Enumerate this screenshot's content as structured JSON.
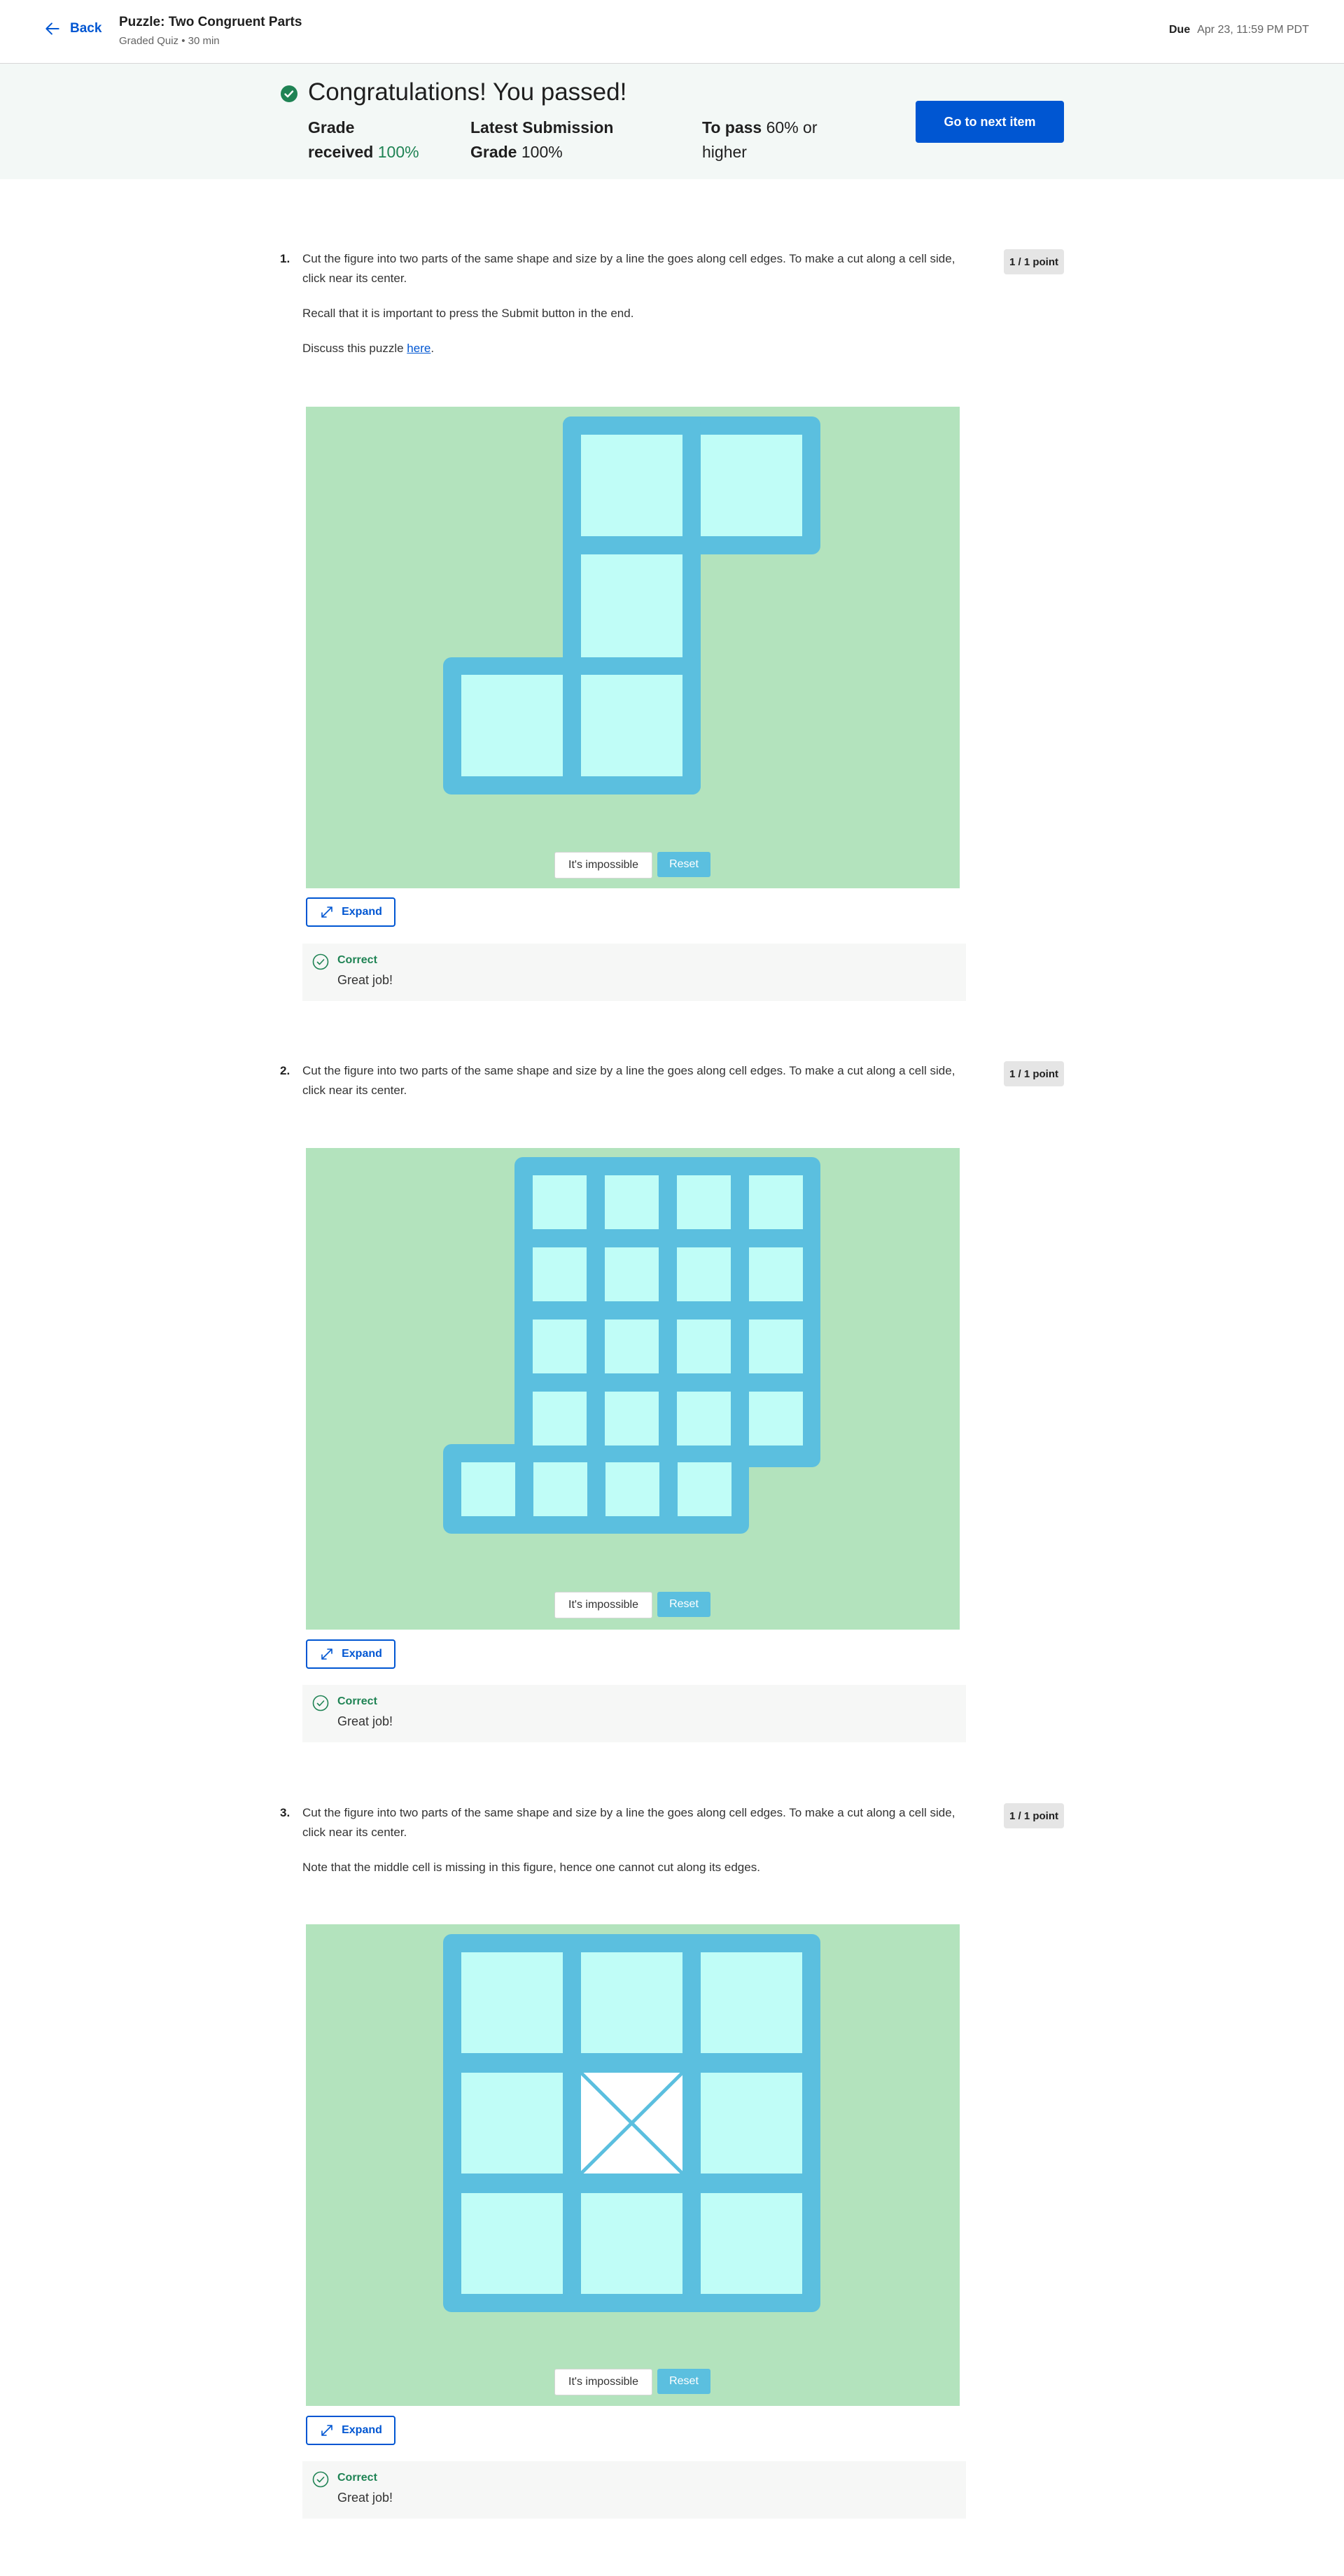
{
  "header": {
    "back_label": "Back",
    "title": "Puzzle: Two Congruent Parts",
    "subtitle": "Graded Quiz • 30 min",
    "due_label": "Due",
    "due_value": "Apr 23, 11:59 PM PDT"
  },
  "banner": {
    "title": "Congratulations! You passed!",
    "grade_label_1": "Grade",
    "grade_label_2": "received",
    "grade_value": "100%",
    "latest_label_1": "Latest Submission",
    "latest_label_2": "Grade",
    "latest_value": "100%",
    "pass_label": "To pass",
    "pass_value": "60%",
    "pass_suffix_1": "or",
    "pass_suffix_2": "higher",
    "next_button": "Go to next item"
  },
  "colors": {
    "accent": "#0056d2",
    "success": "#1f8354",
    "canvas_bg": "#b3e3bd",
    "piece_frame": "#5bbfdf",
    "piece_cell": "#c0fdf7"
  },
  "questions": [
    {
      "number": "1.",
      "text_1": "Cut the figure into two parts of the same shape and size by a line the goes along cell edges. To make a cut along a cell side, click near its center.",
      "text_2": "Recall that it is important to press the Submit button in the end.",
      "text_3_prefix": "Discuss this puzzle ",
      "text_3_link": "here",
      "text_3_suffix": ".",
      "points": "1 / 1 point",
      "impossible_label": "It's impossible",
      "reset_label": "Reset",
      "expand_label": "Expand",
      "feedback_status": "Correct",
      "feedback_message": "Great job!"
    },
    {
      "number": "2.",
      "text_1": "Cut the figure into two parts of the same shape and size by a line the goes along cell edges. To make a cut along a cell side, click near its center.",
      "points": "1 / 1 point",
      "impossible_label": "It's impossible",
      "reset_label": "Reset",
      "expand_label": "Expand",
      "feedback_status": "Correct",
      "feedback_message": "Great job!"
    },
    {
      "number": "3.",
      "text_1": "Cut the figure into two parts of the same shape and size by a line the goes along cell edges. To make a cut along a cell side, click near its center.",
      "text_2": "Note that the middle cell is missing in this figure, hence one cannot cut along its edges.",
      "points": "1 / 1 point",
      "impossible_label": "It's impossible",
      "reset_label": "Reset",
      "expand_label": "Expand",
      "feedback_status": "Correct",
      "feedback_message": "Great job!"
    }
  ]
}
